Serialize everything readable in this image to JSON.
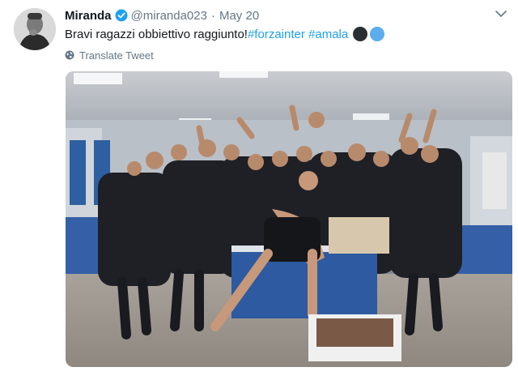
{
  "tweet": {
    "display_name": "Miranda",
    "handle": "@miranda023",
    "separator": "·",
    "date": "May 20",
    "text_plain": "Bravi ragazzi obbiettivo raggiunto!",
    "hashtag_1": "#forzainter",
    "hashtag_2": "#amala",
    "translate_label": "Translate Tweet",
    "icons": {
      "verified": "verified-badge-icon",
      "caret": "chevron-down-icon",
      "globe": "globe-icon",
      "emoji_1": "black-circle-emoji",
      "emoji_2": "blue-circle-emoji"
    },
    "colors": {
      "link": "#1da1f2",
      "secondary_text": "#657786",
      "primary_text": "#14171a"
    }
  }
}
